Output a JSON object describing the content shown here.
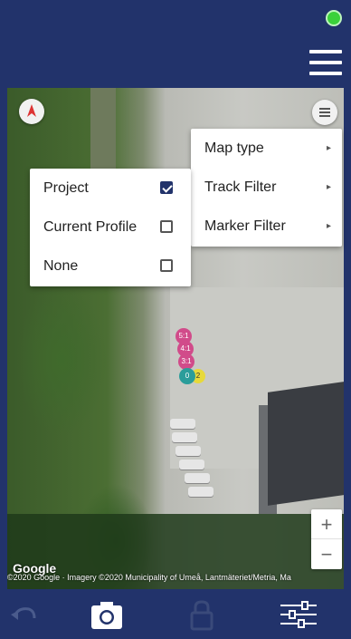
{
  "header": {
    "status_indicator": "connected-status-icon",
    "menu_icon": "hamburger-menu-icon",
    "status_color": "#3ad13a"
  },
  "map": {
    "compass_icon": "compass-icon",
    "layers_icon": "layers-menu-icon",
    "google_logo": "Google",
    "attribution": "©2020 Google · Imagery ©2020 Municipality of Umeå, Lantmäteriet/Metria, Ma",
    "zoom_in": "+",
    "zoom_out": "−",
    "markers": [
      {
        "label": "5:1",
        "color": "#d14b8a"
      },
      {
        "label": "4:1",
        "color": "#d14b8a"
      },
      {
        "label": "3:1",
        "color": "#d14b8a"
      },
      {
        "label": "0",
        "color": "#2a9d9a"
      },
      {
        "label": "2",
        "color": "#e7d93a"
      }
    ]
  },
  "menu": {
    "items": [
      {
        "label": "Map type",
        "arrow": "▸"
      },
      {
        "label": "Track Filter",
        "arrow": "▸"
      },
      {
        "label": "Marker Filter",
        "arrow": "▸"
      }
    ]
  },
  "submenu": {
    "items": [
      {
        "label": "Project",
        "checked": true
      },
      {
        "label": "Current Profile",
        "checked": false
      },
      {
        "label": "None",
        "checked": false
      }
    ]
  },
  "bottombar": {
    "back_icon": "undo-arrow-icon",
    "camera_icon": "camera-icon",
    "lock_icon": "lock-icon",
    "settings_icon": "sliders-settings-icon",
    "accent": "#22336b"
  }
}
